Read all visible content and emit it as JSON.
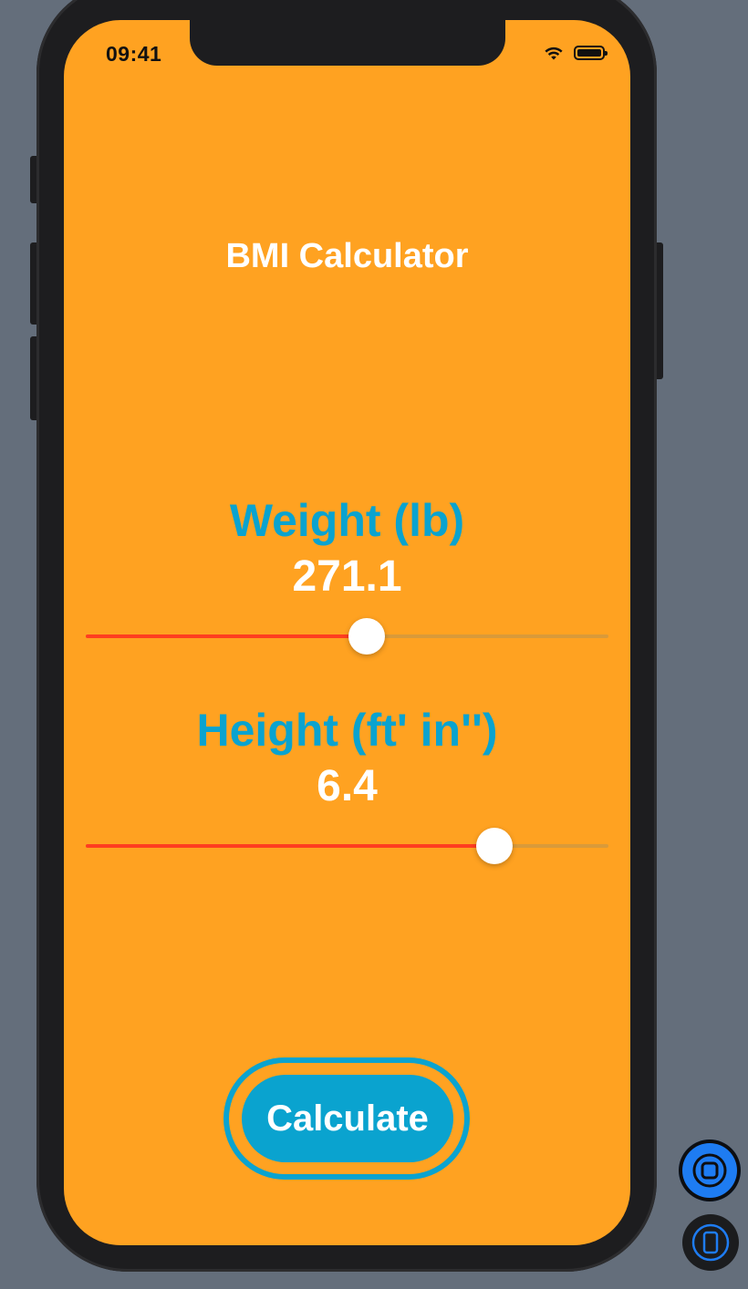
{
  "status_bar": {
    "time": "09:41",
    "wifi_icon": "wifi-icon",
    "battery_icon": "battery-icon"
  },
  "app": {
    "title": "BMI Calculator"
  },
  "weight": {
    "label": "Weight (lb)",
    "value": "271.1",
    "slider_fraction": 0.537
  },
  "height": {
    "label": "Height (ft' in'')",
    "value": "6.4",
    "slider_fraction": 0.782
  },
  "calculate_button": {
    "label": "Calculate"
  },
  "colors": {
    "background": "#ffa221",
    "accent": "#0aa3cf",
    "slider_fill": "#ff3d20",
    "text_primary": "#ffffff"
  },
  "simulator_controls": {
    "home_icon": "home-button-icon",
    "rotate_icon": "rotate-device-icon"
  }
}
